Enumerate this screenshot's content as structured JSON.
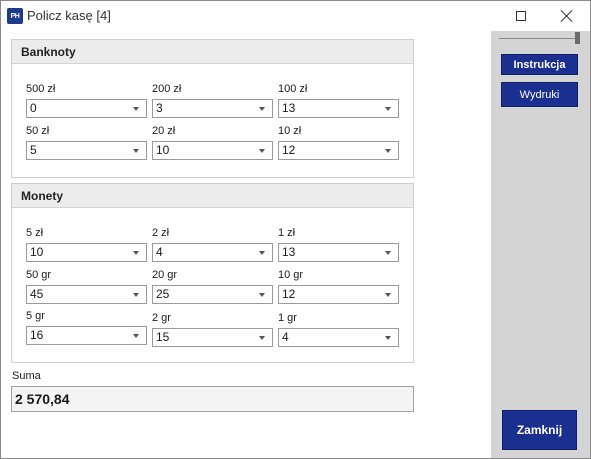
{
  "window": {
    "title": "Policz kasę [4]",
    "app_icon_text": "PH"
  },
  "banknoty": {
    "header": "Banknoty",
    "fields": [
      {
        "label": "500 zł",
        "value": "0"
      },
      {
        "label": "200 zł",
        "value": "3"
      },
      {
        "label": "100 zł",
        "value": "13"
      },
      {
        "label": "50 zł",
        "value": "5"
      },
      {
        "label": "20 zł",
        "value": "10"
      },
      {
        "label": "10 zł",
        "value": "12"
      }
    ]
  },
  "monety": {
    "header": "Monety",
    "fields": [
      {
        "label": "5 zł",
        "value": "10"
      },
      {
        "label": "2 zł",
        "value": "4"
      },
      {
        "label": "1 zł",
        "value": "13"
      },
      {
        "label": "50 gr",
        "value": "45"
      },
      {
        "label": "20 gr",
        "value": "25"
      },
      {
        "label": "10 gr",
        "value": "12"
      },
      {
        "label": "5 gr",
        "value": "16"
      },
      {
        "label": "2 gr",
        "value": "15"
      },
      {
        "label": "1 gr",
        "value": "4"
      }
    ]
  },
  "suma": {
    "label": "Suma",
    "value": "2 570,84"
  },
  "side": {
    "instrukcja_label": "Instrukcja",
    "wydruki_label": "Wydruki",
    "zamknij_label": "Zamknij"
  },
  "colors": {
    "accent": "#1a2f8f",
    "panel": "#d4d4d4",
    "group_header": "#ececec"
  }
}
